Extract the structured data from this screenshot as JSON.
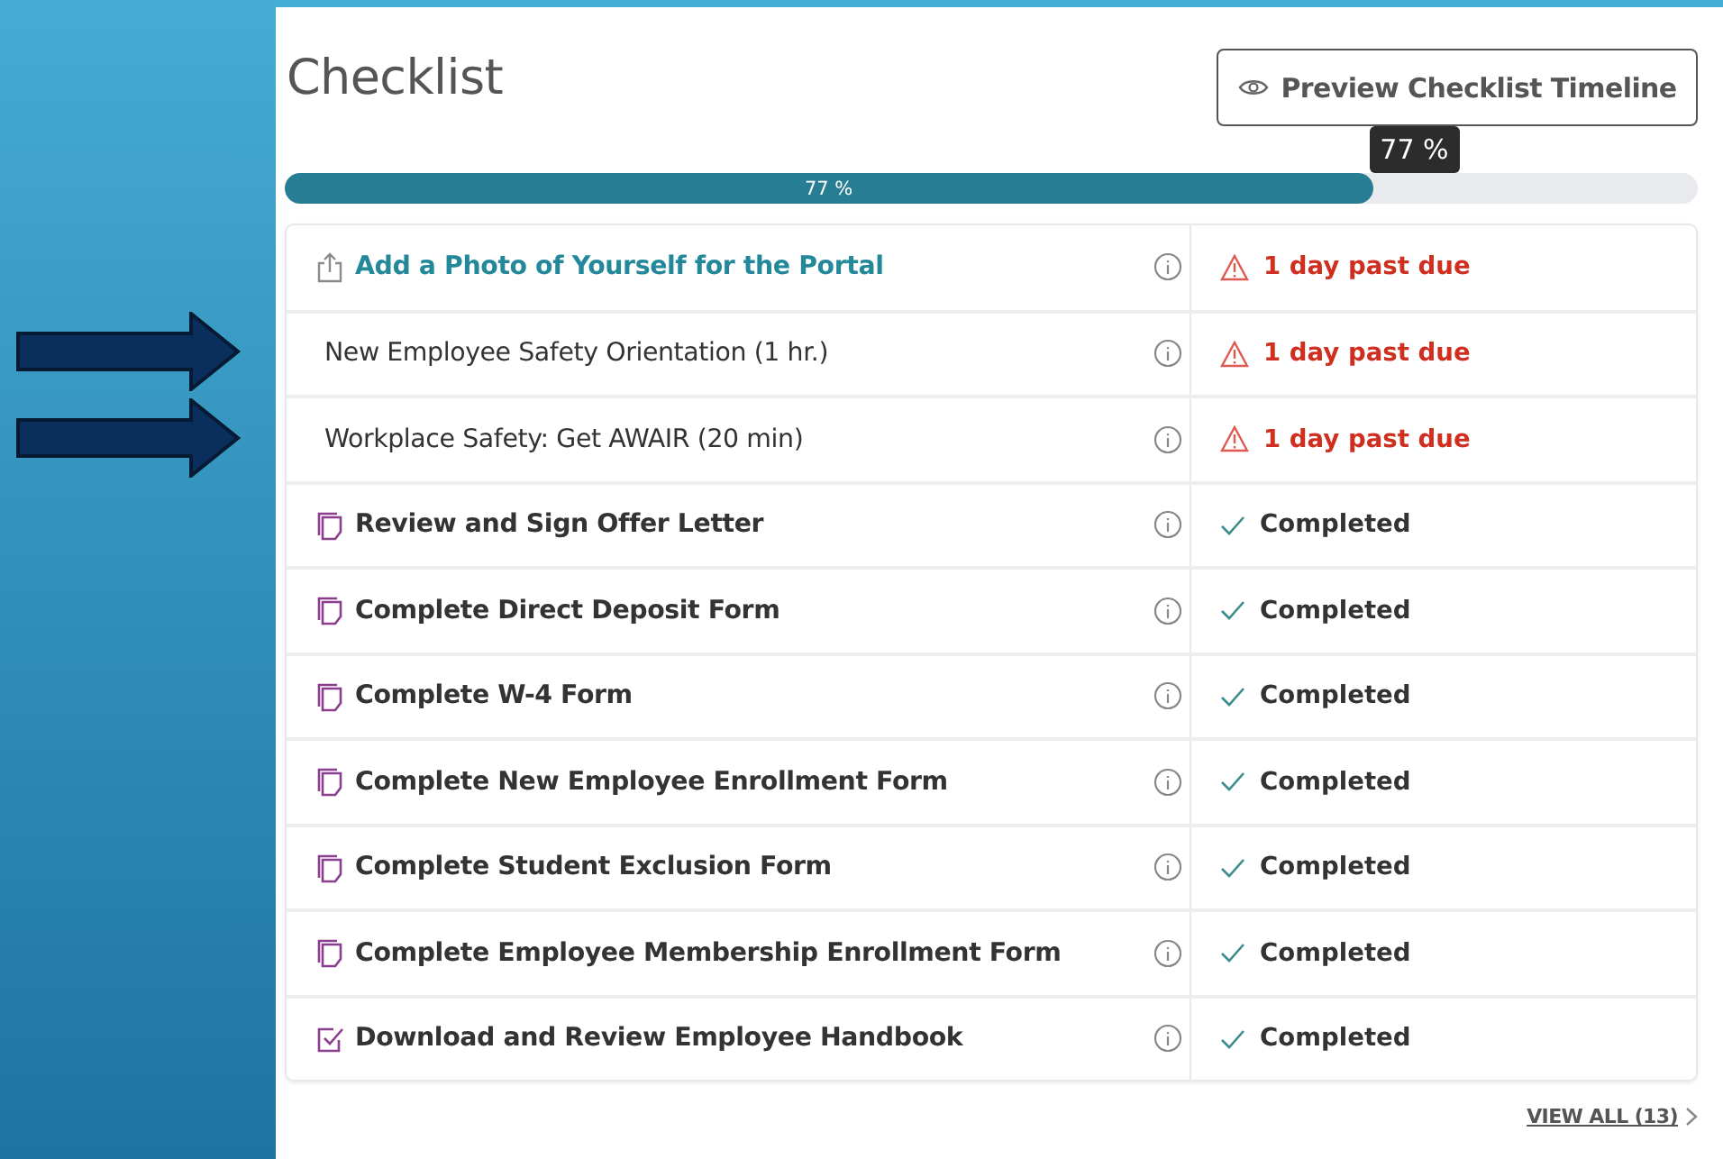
{
  "title": "Checklist",
  "preview_button": {
    "label": "Preview Checklist Timeline"
  },
  "progress": {
    "level": 0.77,
    "label": "77 %",
    "tooltip": "77 %"
  },
  "rows": [
    {
      "title": "Add a Photo of Yourself for the Portal",
      "kind": "upload",
      "link": true,
      "bold": true,
      "pointed": false,
      "status": {
        "kind": "overdue",
        "text": "1 day past due"
      }
    },
    {
      "title": "New Employee Safety Orientation (1 hr.)",
      "kind": "plain",
      "link": false,
      "bold": false,
      "pointed": true,
      "status": {
        "kind": "overdue",
        "text": "1 day past due"
      }
    },
    {
      "title": "Workplace Safety: Get AWAIR (20 min)",
      "kind": "plain",
      "link": false,
      "bold": false,
      "pointed": true,
      "status": {
        "kind": "overdue",
        "text": "1 day past due"
      }
    },
    {
      "title": "Review and Sign Offer Letter",
      "kind": "document",
      "link": false,
      "bold": true,
      "pointed": false,
      "status": {
        "kind": "completed",
        "text": "Completed"
      }
    },
    {
      "title": "Complete Direct Deposit Form",
      "kind": "document",
      "link": false,
      "bold": true,
      "pointed": false,
      "status": {
        "kind": "completed",
        "text": "Completed"
      }
    },
    {
      "title": "Complete W-4 Form",
      "kind": "document",
      "link": false,
      "bold": true,
      "pointed": false,
      "status": {
        "kind": "completed",
        "text": "Completed"
      }
    },
    {
      "title": "Complete New Employee Enrollment Form",
      "kind": "document",
      "link": false,
      "bold": true,
      "pointed": false,
      "status": {
        "kind": "completed",
        "text": "Completed"
      }
    },
    {
      "title": "Complete Student Exclusion Form",
      "kind": "document",
      "link": false,
      "bold": true,
      "pointed": false,
      "status": {
        "kind": "completed",
        "text": "Completed"
      }
    },
    {
      "title": "Complete Employee Membership Enrollment Form",
      "kind": "document",
      "link": false,
      "bold": true,
      "pointed": false,
      "status": {
        "kind": "completed",
        "text": "Completed"
      }
    },
    {
      "title": "Download and Review Employee Handbook",
      "kind": "checkbox",
      "link": false,
      "bold": true,
      "pointed": false,
      "status": {
        "kind": "completed",
        "text": "Completed"
      }
    }
  ],
  "view_all": "VIEW ALL (13)"
}
